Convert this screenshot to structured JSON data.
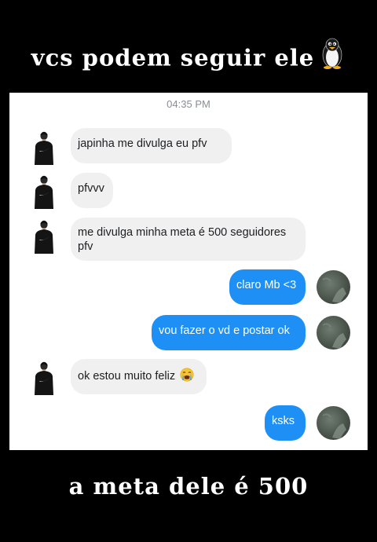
{
  "captions": {
    "top": "vcs podem seguir ele",
    "bottom": "a meta dele é 500"
  },
  "icons": {
    "penguin": "penguin-emoji",
    "crying": "loudly-crying-face-emoji"
  },
  "chat": {
    "timestamp": "04:35 PM",
    "messages": [
      {
        "direction": "incoming",
        "text": "japinha me divulga eu pfv"
      },
      {
        "direction": "incoming",
        "text": "pfvvv"
      },
      {
        "direction": "incoming",
        "text": "me divulga minha meta é 500 seguidores pfv"
      },
      {
        "direction": "outgoing",
        "text": "claro Mb <3"
      },
      {
        "direction": "outgoing",
        "text": "vou fazer o vd e postar ok"
      },
      {
        "direction": "incoming",
        "text": "ok estou muito feliz"
      },
      {
        "direction": "outgoing",
        "text": "ksks"
      }
    ]
  },
  "colors": {
    "background": "#000000",
    "chat_background": "#ffffff",
    "incoming_bubble": "#f0f0f0",
    "outgoing_bubble": "#1e90f5"
  }
}
